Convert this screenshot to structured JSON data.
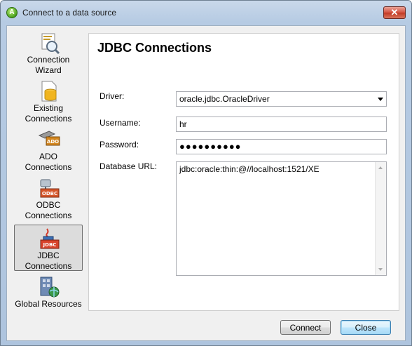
{
  "window": {
    "title": "Connect to a data source",
    "close_glyph": "✕"
  },
  "sidebar": {
    "items": [
      {
        "line1": "Connection",
        "line2": "Wizard",
        "icon": "connection-wizard-icon",
        "selected": false
      },
      {
        "line1": "Existing",
        "line2": "Connections",
        "icon": "existing-connections-icon",
        "selected": false
      },
      {
        "line1": "ADO",
        "line2": "Connections",
        "icon": "ado-connections-icon",
        "selected": false
      },
      {
        "line1": "ODBC",
        "line2": "Connections",
        "icon": "odbc-connections-icon",
        "selected": false
      },
      {
        "line1": "JDBC",
        "line2": "Connections",
        "icon": "jdbc-connections-icon",
        "selected": true
      },
      {
        "line1": "Global Resources",
        "line2": "",
        "icon": "global-resources-icon",
        "selected": false
      }
    ]
  },
  "panel": {
    "title": "JDBC Connections",
    "driver": {
      "label": "Driver:",
      "value": "oracle.jdbc.OracleDriver"
    },
    "username": {
      "label": "Username:",
      "value": "hr"
    },
    "password": {
      "label": "Password:",
      "value": "●●●●●●●●●●"
    },
    "url": {
      "label": "Database URL:",
      "value": "jdbc:oracle:thin:@//localhost:1521/XE"
    }
  },
  "buttons": {
    "connect": "Connect",
    "close": "Close"
  }
}
